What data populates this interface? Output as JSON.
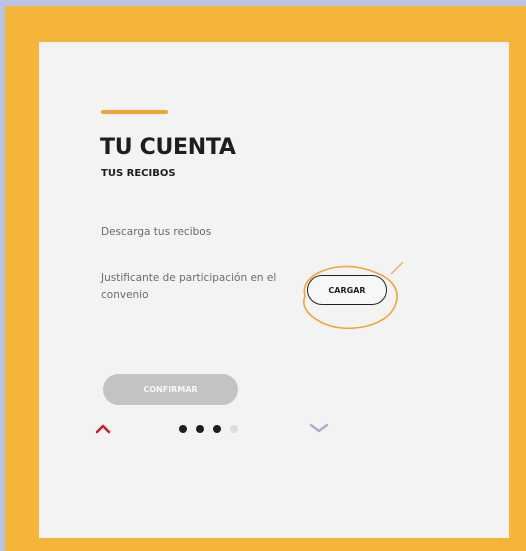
{
  "section": {
    "title": "TU CUENTA",
    "subtitle": "TUS RECIBOS"
  },
  "content": {
    "description": "Descarga tus recibos",
    "field_label": "Justificante de participación en el convenio",
    "upload_label": "CARGAR"
  },
  "footer": {
    "confirm_label": "CONFIRMAR",
    "pagination": {
      "total": 4,
      "active_dots": 3
    }
  },
  "colors": {
    "outer_background": "#b9c3e6",
    "frame": "#f4b53a",
    "accent": "#f0a536",
    "nav_up": "#c8202f",
    "nav_down": "#a6afc8",
    "confirm_disabled": "#c3c3c3"
  },
  "icons": {
    "nav_up": "chevron-up-icon",
    "nav_down": "chevron-down-icon"
  }
}
